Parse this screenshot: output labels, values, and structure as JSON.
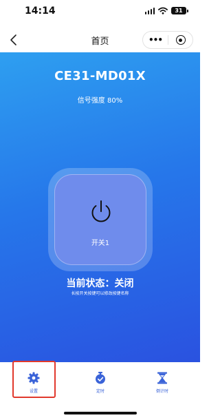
{
  "status_bar": {
    "time": "14:14",
    "battery": "31"
  },
  "nav": {
    "title": "首页",
    "more_label": "•••"
  },
  "device": {
    "name": "CE31-MD01X",
    "signal_strength": "信号强度 80%"
  },
  "switch": {
    "label": "开关1"
  },
  "state": {
    "text": "当前状态：关闭",
    "hint": "长按开关按键可以修改按键名称"
  },
  "tabs": [
    {
      "label": "设置",
      "icon": "gear-icon"
    },
    {
      "label": "定时",
      "icon": "stopwatch-icon"
    },
    {
      "label": "倒计时",
      "icon": "hourglass-icon"
    }
  ],
  "colors": {
    "accent": "#3a63d8",
    "panel_top": "#2e9ff0",
    "panel_bottom": "#2a52e0",
    "highlight": "#e1382c"
  }
}
